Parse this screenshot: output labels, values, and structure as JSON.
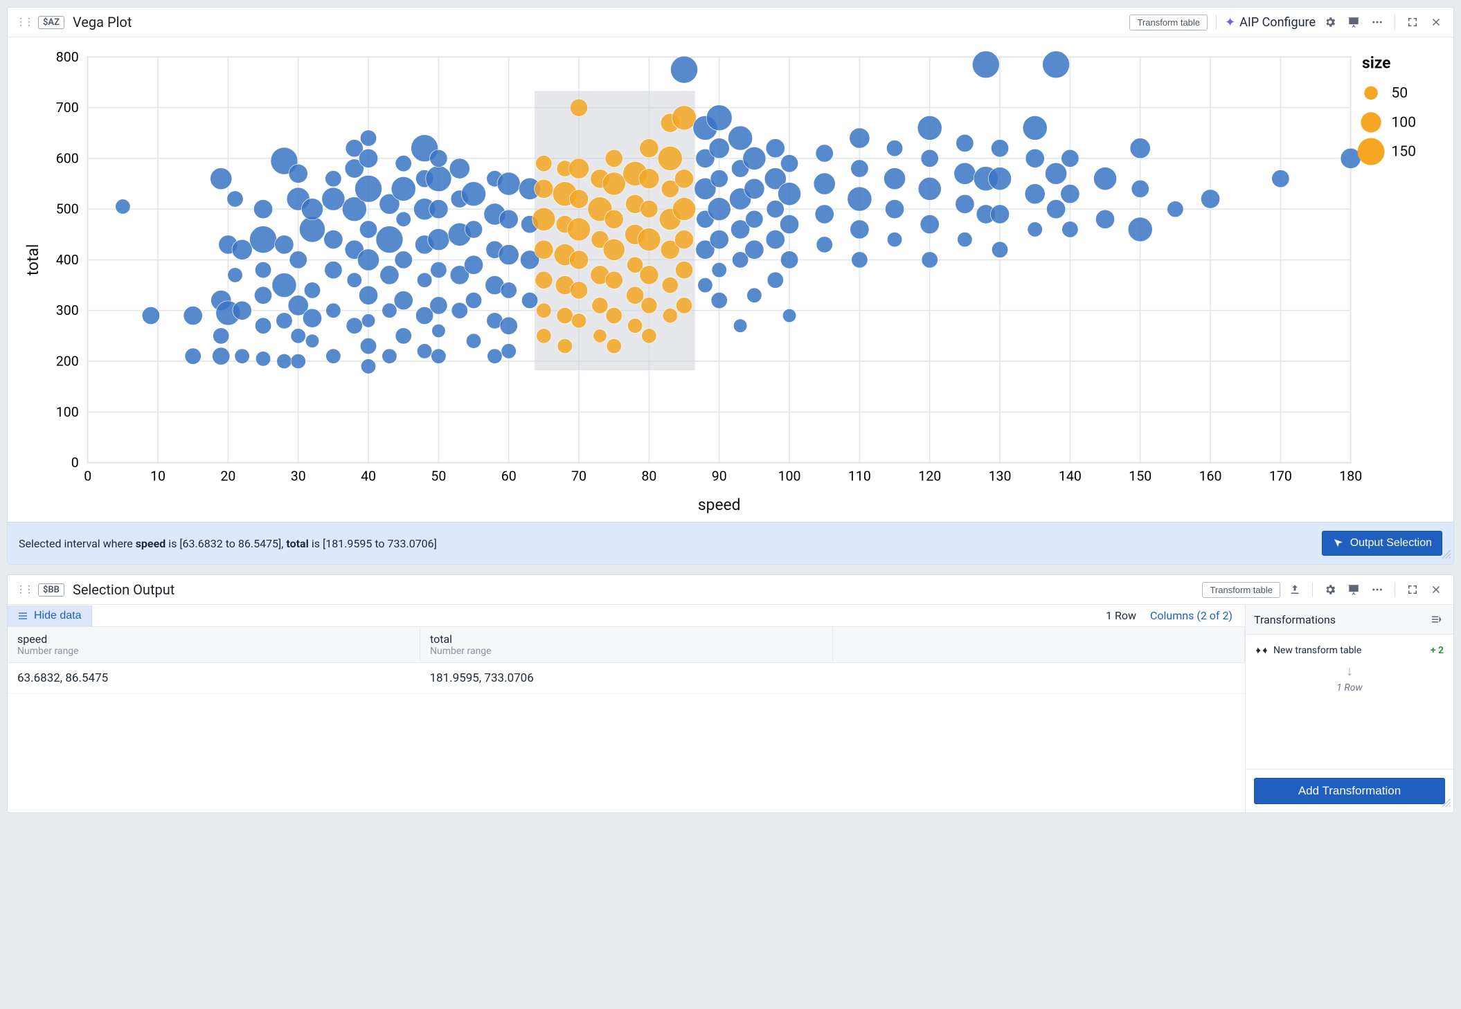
{
  "panel1": {
    "var_tag": "$AZ",
    "title": "Vega Plot",
    "transform_btn": "Transform table",
    "aip_label": "AIP Configure"
  },
  "chart_data": {
    "type": "scatter",
    "xlabel": "speed",
    "ylabel": "total",
    "xlim": [
      0,
      180
    ],
    "ylim": [
      0,
      800
    ],
    "xticks": [
      0,
      10,
      20,
      30,
      40,
      50,
      60,
      70,
      80,
      90,
      100,
      110,
      120,
      130,
      140,
      150,
      160,
      170,
      180
    ],
    "yticks": [
      0,
      100,
      200,
      300,
      400,
      500,
      600,
      700,
      800
    ],
    "legend": {
      "title": "size",
      "items": [
        50,
        100,
        150
      ]
    },
    "brush": {
      "x": [
        63.6832,
        86.5475
      ],
      "y": [
        181.9595,
        733.0706
      ]
    },
    "points": [
      {
        "x": 5,
        "y": 505,
        "s": 60
      },
      {
        "x": 9,
        "y": 290,
        "s": 80
      },
      {
        "x": 15,
        "y": 290,
        "s": 90
      },
      {
        "x": 15,
        "y": 210,
        "s": 70
      },
      {
        "x": 19,
        "y": 320,
        "s": 100
      },
      {
        "x": 19,
        "y": 250,
        "s": 70
      },
      {
        "x": 19,
        "y": 210,
        "s": 80
      },
      {
        "x": 19,
        "y": 560,
        "s": 110
      },
      {
        "x": 20,
        "y": 430,
        "s": 90
      },
      {
        "x": 20,
        "y": 295,
        "s": 130
      },
      {
        "x": 21,
        "y": 370,
        "s": 60
      },
      {
        "x": 21,
        "y": 520,
        "s": 70
      },
      {
        "x": 22,
        "y": 300,
        "s": 90
      },
      {
        "x": 22,
        "y": 420,
        "s": 100
      },
      {
        "x": 22,
        "y": 210,
        "s": 60
      },
      {
        "x": 25,
        "y": 330,
        "s": 80
      },
      {
        "x": 25,
        "y": 270,
        "s": 70
      },
      {
        "x": 25,
        "y": 500,
        "s": 90
      },
      {
        "x": 25,
        "y": 440,
        "s": 150
      },
      {
        "x": 25,
        "y": 380,
        "s": 70
      },
      {
        "x": 25,
        "y": 205,
        "s": 60
      },
      {
        "x": 28,
        "y": 430,
        "s": 90
      },
      {
        "x": 28,
        "y": 350,
        "s": 130
      },
      {
        "x": 28,
        "y": 280,
        "s": 70
      },
      {
        "x": 28,
        "y": 595,
        "s": 150
      },
      {
        "x": 28,
        "y": 200,
        "s": 60
      },
      {
        "x": 30,
        "y": 250,
        "s": 60
      },
      {
        "x": 30,
        "y": 310,
        "s": 100
      },
      {
        "x": 30,
        "y": 400,
        "s": 80
      },
      {
        "x": 30,
        "y": 520,
        "s": 120
      },
      {
        "x": 30,
        "y": 570,
        "s": 90
      },
      {
        "x": 30,
        "y": 200,
        "s": 60
      },
      {
        "x": 32,
        "y": 460,
        "s": 140
      },
      {
        "x": 32,
        "y": 340,
        "s": 70
      },
      {
        "x": 32,
        "y": 285,
        "s": 90
      },
      {
        "x": 32,
        "y": 240,
        "s": 50
      },
      {
        "x": 32,
        "y": 500,
        "s": 110
      },
      {
        "x": 35,
        "y": 440,
        "s": 90
      },
      {
        "x": 35,
        "y": 380,
        "s": 80
      },
      {
        "x": 35,
        "y": 300,
        "s": 60
      },
      {
        "x": 35,
        "y": 520,
        "s": 120
      },
      {
        "x": 35,
        "y": 560,
        "s": 70
      },
      {
        "x": 35,
        "y": 210,
        "s": 60
      },
      {
        "x": 38,
        "y": 500,
        "s": 130
      },
      {
        "x": 38,
        "y": 420,
        "s": 90
      },
      {
        "x": 38,
        "y": 360,
        "s": 60
      },
      {
        "x": 38,
        "y": 270,
        "s": 70
      },
      {
        "x": 38,
        "y": 580,
        "s": 90
      },
      {
        "x": 38,
        "y": 620,
        "s": 80
      },
      {
        "x": 40,
        "y": 190,
        "s": 60
      },
      {
        "x": 40,
        "y": 230,
        "s": 70
      },
      {
        "x": 40,
        "y": 280,
        "s": 50
      },
      {
        "x": 40,
        "y": 330,
        "s": 90
      },
      {
        "x": 40,
        "y": 400,
        "s": 110
      },
      {
        "x": 40,
        "y": 460,
        "s": 80
      },
      {
        "x": 40,
        "y": 540,
        "s": 150
      },
      {
        "x": 40,
        "y": 600,
        "s": 90
      },
      {
        "x": 40,
        "y": 640,
        "s": 70
      },
      {
        "x": 43,
        "y": 210,
        "s": 60
      },
      {
        "x": 43,
        "y": 370,
        "s": 90
      },
      {
        "x": 43,
        "y": 440,
        "s": 150
      },
      {
        "x": 43,
        "y": 510,
        "s": 100
      },
      {
        "x": 43,
        "y": 300,
        "s": 60
      },
      {
        "x": 45,
        "y": 250,
        "s": 70
      },
      {
        "x": 45,
        "y": 320,
        "s": 90
      },
      {
        "x": 45,
        "y": 400,
        "s": 80
      },
      {
        "x": 45,
        "y": 480,
        "s": 60
      },
      {
        "x": 45,
        "y": 540,
        "s": 130
      },
      {
        "x": 45,
        "y": 590,
        "s": 70
      },
      {
        "x": 48,
        "y": 220,
        "s": 60
      },
      {
        "x": 48,
        "y": 290,
        "s": 80
      },
      {
        "x": 48,
        "y": 360,
        "s": 60
      },
      {
        "x": 48,
        "y": 430,
        "s": 90
      },
      {
        "x": 48,
        "y": 500,
        "s": 110
      },
      {
        "x": 48,
        "y": 560,
        "s": 80
      },
      {
        "x": 48,
        "y": 620,
        "s": 150
      },
      {
        "x": 50,
        "y": 210,
        "s": 60
      },
      {
        "x": 50,
        "y": 260,
        "s": 50
      },
      {
        "x": 50,
        "y": 310,
        "s": 80
      },
      {
        "x": 50,
        "y": 380,
        "s": 70
      },
      {
        "x": 50,
        "y": 440,
        "s": 110
      },
      {
        "x": 50,
        "y": 500,
        "s": 90
      },
      {
        "x": 50,
        "y": 560,
        "s": 140
      },
      {
        "x": 50,
        "y": 600,
        "s": 80
      },
      {
        "x": 53,
        "y": 300,
        "s": 70
      },
      {
        "x": 53,
        "y": 370,
        "s": 90
      },
      {
        "x": 53,
        "y": 450,
        "s": 120
      },
      {
        "x": 53,
        "y": 520,
        "s": 80
      },
      {
        "x": 53,
        "y": 580,
        "s": 100
      },
      {
        "x": 55,
        "y": 240,
        "s": 60
      },
      {
        "x": 55,
        "y": 320,
        "s": 70
      },
      {
        "x": 55,
        "y": 390,
        "s": 90
      },
      {
        "x": 55,
        "y": 460,
        "s": 80
      },
      {
        "x": 55,
        "y": 530,
        "s": 130
      },
      {
        "x": 58,
        "y": 210,
        "s": 60
      },
      {
        "x": 58,
        "y": 280,
        "s": 70
      },
      {
        "x": 58,
        "y": 350,
        "s": 90
      },
      {
        "x": 58,
        "y": 420,
        "s": 80
      },
      {
        "x": 58,
        "y": 490,
        "s": 110
      },
      {
        "x": 58,
        "y": 560,
        "s": 70
      },
      {
        "x": 60,
        "y": 220,
        "s": 60
      },
      {
        "x": 60,
        "y": 270,
        "s": 80
      },
      {
        "x": 60,
        "y": 340,
        "s": 70
      },
      {
        "x": 60,
        "y": 410,
        "s": 100
      },
      {
        "x": 60,
        "y": 480,
        "s": 90
      },
      {
        "x": 60,
        "y": 550,
        "s": 120
      },
      {
        "x": 63,
        "y": 320,
        "s": 70
      },
      {
        "x": 63,
        "y": 400,
        "s": 90
      },
      {
        "x": 63,
        "y": 470,
        "s": 80
      },
      {
        "x": 63,
        "y": 540,
        "s": 110
      },
      {
        "x": 65,
        "y": 250,
        "s": 60
      },
      {
        "x": 65,
        "y": 300,
        "s": 60
      },
      {
        "x": 65,
        "y": 360,
        "s": 80
      },
      {
        "x": 65,
        "y": 420,
        "s": 90
      },
      {
        "x": 65,
        "y": 480,
        "s": 120
      },
      {
        "x": 65,
        "y": 540,
        "s": 90
      },
      {
        "x": 65,
        "y": 590,
        "s": 70
      },
      {
        "x": 68,
        "y": 230,
        "s": 60
      },
      {
        "x": 68,
        "y": 290,
        "s": 70
      },
      {
        "x": 68,
        "y": 350,
        "s": 90
      },
      {
        "x": 68,
        "y": 410,
        "s": 110
      },
      {
        "x": 68,
        "y": 470,
        "s": 80
      },
      {
        "x": 68,
        "y": 530,
        "s": 130
      },
      {
        "x": 68,
        "y": 580,
        "s": 70
      },
      {
        "x": 70,
        "y": 280,
        "s": 60
      },
      {
        "x": 70,
        "y": 340,
        "s": 80
      },
      {
        "x": 70,
        "y": 400,
        "s": 90
      },
      {
        "x": 70,
        "y": 460,
        "s": 120
      },
      {
        "x": 70,
        "y": 520,
        "s": 90
      },
      {
        "x": 70,
        "y": 580,
        "s": 100
      },
      {
        "x": 70,
        "y": 700,
        "s": 80
      },
      {
        "x": 73,
        "y": 250,
        "s": 50
      },
      {
        "x": 73,
        "y": 310,
        "s": 70
      },
      {
        "x": 73,
        "y": 370,
        "s": 90
      },
      {
        "x": 73,
        "y": 440,
        "s": 80
      },
      {
        "x": 73,
        "y": 500,
        "s": 130
      },
      {
        "x": 73,
        "y": 560,
        "s": 90
      },
      {
        "x": 75,
        "y": 230,
        "s": 60
      },
      {
        "x": 75,
        "y": 290,
        "s": 70
      },
      {
        "x": 75,
        "y": 360,
        "s": 80
      },
      {
        "x": 75,
        "y": 420,
        "s": 110
      },
      {
        "x": 75,
        "y": 480,
        "s": 90
      },
      {
        "x": 75,
        "y": 550,
        "s": 120
      },
      {
        "x": 75,
        "y": 600,
        "s": 80
      },
      {
        "x": 78,
        "y": 270,
        "s": 60
      },
      {
        "x": 78,
        "y": 330,
        "s": 80
      },
      {
        "x": 78,
        "y": 390,
        "s": 70
      },
      {
        "x": 78,
        "y": 450,
        "s": 100
      },
      {
        "x": 78,
        "y": 510,
        "s": 90
      },
      {
        "x": 78,
        "y": 570,
        "s": 130
      },
      {
        "x": 80,
        "y": 250,
        "s": 60
      },
      {
        "x": 80,
        "y": 310,
        "s": 70
      },
      {
        "x": 80,
        "y": 370,
        "s": 90
      },
      {
        "x": 80,
        "y": 440,
        "s": 120
      },
      {
        "x": 80,
        "y": 500,
        "s": 80
      },
      {
        "x": 80,
        "y": 560,
        "s": 100
      },
      {
        "x": 80,
        "y": 620,
        "s": 90
      },
      {
        "x": 83,
        "y": 290,
        "s": 60
      },
      {
        "x": 83,
        "y": 350,
        "s": 70
      },
      {
        "x": 83,
        "y": 420,
        "s": 90
      },
      {
        "x": 83,
        "y": 480,
        "s": 110
      },
      {
        "x": 83,
        "y": 540,
        "s": 80
      },
      {
        "x": 83,
        "y": 600,
        "s": 130
      },
      {
        "x": 83,
        "y": 670,
        "s": 90
      },
      {
        "x": 85,
        "y": 310,
        "s": 70
      },
      {
        "x": 85,
        "y": 380,
        "s": 80
      },
      {
        "x": 85,
        "y": 440,
        "s": 90
      },
      {
        "x": 85,
        "y": 500,
        "s": 120
      },
      {
        "x": 85,
        "y": 560,
        "s": 90
      },
      {
        "x": 85,
        "y": 680,
        "s": 130
      },
      {
        "x": 85,
        "y": 775,
        "s": 150
      },
      {
        "x": 88,
        "y": 350,
        "s": 60
      },
      {
        "x": 88,
        "y": 420,
        "s": 90
      },
      {
        "x": 88,
        "y": 480,
        "s": 80
      },
      {
        "x": 88,
        "y": 540,
        "s": 110
      },
      {
        "x": 88,
        "y": 600,
        "s": 90
      },
      {
        "x": 88,
        "y": 660,
        "s": 130
      },
      {
        "x": 90,
        "y": 320,
        "s": 70
      },
      {
        "x": 90,
        "y": 380,
        "s": 60
      },
      {
        "x": 90,
        "y": 440,
        "s": 90
      },
      {
        "x": 90,
        "y": 500,
        "s": 120
      },
      {
        "x": 90,
        "y": 560,
        "s": 80
      },
      {
        "x": 90,
        "y": 620,
        "s": 100
      },
      {
        "x": 90,
        "y": 680,
        "s": 140
      },
      {
        "x": 93,
        "y": 270,
        "s": 50
      },
      {
        "x": 93,
        "y": 400,
        "s": 70
      },
      {
        "x": 93,
        "y": 460,
        "s": 90
      },
      {
        "x": 93,
        "y": 520,
        "s": 110
      },
      {
        "x": 93,
        "y": 580,
        "s": 80
      },
      {
        "x": 93,
        "y": 640,
        "s": 130
      },
      {
        "x": 95,
        "y": 330,
        "s": 60
      },
      {
        "x": 95,
        "y": 420,
        "s": 90
      },
      {
        "x": 95,
        "y": 480,
        "s": 80
      },
      {
        "x": 95,
        "y": 540,
        "s": 100
      },
      {
        "x": 95,
        "y": 600,
        "s": 120
      },
      {
        "x": 98,
        "y": 360,
        "s": 70
      },
      {
        "x": 98,
        "y": 440,
        "s": 90
      },
      {
        "x": 98,
        "y": 500,
        "s": 80
      },
      {
        "x": 98,
        "y": 560,
        "s": 110
      },
      {
        "x": 98,
        "y": 620,
        "s": 90
      },
      {
        "x": 100,
        "y": 290,
        "s": 50
      },
      {
        "x": 100,
        "y": 400,
        "s": 80
      },
      {
        "x": 100,
        "y": 470,
        "s": 90
      },
      {
        "x": 100,
        "y": 530,
        "s": 120
      },
      {
        "x": 100,
        "y": 590,
        "s": 80
      },
      {
        "x": 105,
        "y": 430,
        "s": 70
      },
      {
        "x": 105,
        "y": 490,
        "s": 90
      },
      {
        "x": 105,
        "y": 550,
        "s": 110
      },
      {
        "x": 105,
        "y": 610,
        "s": 80
      },
      {
        "x": 110,
        "y": 400,
        "s": 70
      },
      {
        "x": 110,
        "y": 460,
        "s": 90
      },
      {
        "x": 110,
        "y": 520,
        "s": 130
      },
      {
        "x": 110,
        "y": 580,
        "s": 80
      },
      {
        "x": 110,
        "y": 640,
        "s": 100
      },
      {
        "x": 115,
        "y": 440,
        "s": 60
      },
      {
        "x": 115,
        "y": 500,
        "s": 90
      },
      {
        "x": 115,
        "y": 560,
        "s": 110
      },
      {
        "x": 115,
        "y": 620,
        "s": 70
      },
      {
        "x": 120,
        "y": 400,
        "s": 70
      },
      {
        "x": 120,
        "y": 470,
        "s": 90
      },
      {
        "x": 120,
        "y": 540,
        "s": 120
      },
      {
        "x": 120,
        "y": 600,
        "s": 80
      },
      {
        "x": 120,
        "y": 660,
        "s": 130
      },
      {
        "x": 125,
        "y": 440,
        "s": 60
      },
      {
        "x": 125,
        "y": 510,
        "s": 90
      },
      {
        "x": 125,
        "y": 570,
        "s": 110
      },
      {
        "x": 125,
        "y": 630,
        "s": 80
      },
      {
        "x": 128,
        "y": 490,
        "s": 90
      },
      {
        "x": 128,
        "y": 560,
        "s": 130
      },
      {
        "x": 128,
        "y": 785,
        "s": 150
      },
      {
        "x": 130,
        "y": 420,
        "s": 70
      },
      {
        "x": 130,
        "y": 490,
        "s": 90
      },
      {
        "x": 130,
        "y": 560,
        "s": 120
      },
      {
        "x": 130,
        "y": 620,
        "s": 80
      },
      {
        "x": 135,
        "y": 460,
        "s": 60
      },
      {
        "x": 135,
        "y": 530,
        "s": 100
      },
      {
        "x": 135,
        "y": 600,
        "s": 90
      },
      {
        "x": 135,
        "y": 660,
        "s": 130
      },
      {
        "x": 138,
        "y": 500,
        "s": 90
      },
      {
        "x": 138,
        "y": 570,
        "s": 110
      },
      {
        "x": 138,
        "y": 785,
        "s": 150
      },
      {
        "x": 140,
        "y": 460,
        "s": 70
      },
      {
        "x": 140,
        "y": 530,
        "s": 90
      },
      {
        "x": 140,
        "y": 600,
        "s": 80
      },
      {
        "x": 145,
        "y": 480,
        "s": 90
      },
      {
        "x": 145,
        "y": 560,
        "s": 120
      },
      {
        "x": 150,
        "y": 460,
        "s": 130
      },
      {
        "x": 150,
        "y": 540,
        "s": 80
      },
      {
        "x": 150,
        "y": 620,
        "s": 100
      },
      {
        "x": 155,
        "y": 500,
        "s": 70
      },
      {
        "x": 160,
        "y": 520,
        "s": 90
      },
      {
        "x": 170,
        "y": 560,
        "s": 80
      },
      {
        "x": 180,
        "y": 600,
        "s": 100
      }
    ]
  },
  "selection": {
    "prefix": "Selected interval where ",
    "field1": "speed",
    "is_text": " is ",
    "range1": "[63.6832 to 86.5475]",
    "sep": ", ",
    "field2": "total",
    "range2": "[181.9595 to 733.0706]",
    "output_btn": "Output Selection"
  },
  "panel2": {
    "var_tag": "$BB",
    "title": "Selection Output",
    "transform_btn": "Transform table",
    "hide_data": "Hide data",
    "row_count": "1 Row",
    "columns_link": "Columns (2 of 2)",
    "columns": [
      {
        "name": "speed",
        "type": "Number range"
      },
      {
        "name": "total",
        "type": "Number range"
      }
    ],
    "rows": [
      {
        "c0": "63.6832, 86.5475",
        "c1": "181.9595, 733.0706"
      }
    ],
    "transformations": {
      "title": "Transformations",
      "new_transform": "New transform table",
      "delta": "+ 2",
      "result": "1 Row",
      "add_btn": "Add Transformation"
    }
  },
  "colors": {
    "point": "#3a74c4",
    "highlight": "#f5a623",
    "primary": "#1f5fc0"
  }
}
